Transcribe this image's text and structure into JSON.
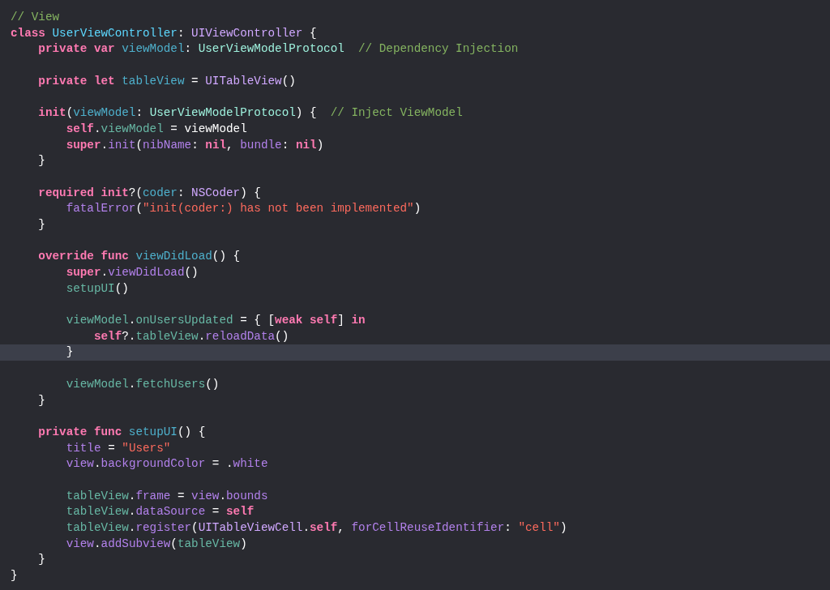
{
  "editor": {
    "lines": [
      {
        "current": false,
        "tokens": [
          {
            "kind": "comment",
            "text": "// View"
          }
        ]
      },
      {
        "current": false,
        "tokens": [
          {
            "kind": "keyword",
            "text": "class "
          },
          {
            "kind": "decltype",
            "text": "UserViewController"
          },
          {
            "kind": "plain",
            "text": ": "
          },
          {
            "kind": "systype",
            "text": "UIViewController"
          },
          {
            "kind": "plain",
            "text": " {"
          }
        ]
      },
      {
        "current": false,
        "tokens": [
          {
            "kind": "keyword",
            "text": "    private var "
          },
          {
            "kind": "decl",
            "text": "viewModel"
          },
          {
            "kind": "plain",
            "text": ": "
          },
          {
            "kind": "projtype",
            "text": "UserViewModelProtocol"
          },
          {
            "kind": "comment",
            "text": "  // Dependency Injection"
          }
        ]
      },
      {
        "current": false
      },
      {
        "current": false,
        "tokens": [
          {
            "kind": "keyword",
            "text": "    private let "
          },
          {
            "kind": "decl",
            "text": "tableView"
          },
          {
            "kind": "plain",
            "text": " = "
          },
          {
            "kind": "systype",
            "text": "UITableView"
          },
          {
            "kind": "plain",
            "text": "()"
          }
        ]
      },
      {
        "current": false
      },
      {
        "current": false,
        "tokens": [
          {
            "kind": "keyword",
            "text": "    init"
          },
          {
            "kind": "plain",
            "text": "("
          },
          {
            "kind": "decl",
            "text": "viewModel"
          },
          {
            "kind": "plain",
            "text": ": "
          },
          {
            "kind": "projtype",
            "text": "UserViewModelProtocol"
          },
          {
            "kind": "plain",
            "text": ") {  "
          },
          {
            "kind": "comment",
            "text": "// Inject ViewModel"
          }
        ]
      },
      {
        "current": false,
        "tokens": [
          {
            "kind": "keyword",
            "text": "        self"
          },
          {
            "kind": "plain",
            "text": "."
          },
          {
            "kind": "projmember",
            "text": "viewModel"
          },
          {
            "kind": "plain",
            "text": " = viewModel"
          }
        ]
      },
      {
        "current": false,
        "tokens": [
          {
            "kind": "keyword",
            "text": "        super"
          },
          {
            "kind": "plain",
            "text": "."
          },
          {
            "kind": "sysmember",
            "text": "init"
          },
          {
            "kind": "plain",
            "text": "("
          },
          {
            "kind": "sysmember",
            "text": "nibName"
          },
          {
            "kind": "plain",
            "text": ": "
          },
          {
            "kind": "keyword",
            "text": "nil"
          },
          {
            "kind": "plain",
            "text": ", "
          },
          {
            "kind": "sysmember",
            "text": "bundle"
          },
          {
            "kind": "plain",
            "text": ": "
          },
          {
            "kind": "keyword",
            "text": "nil"
          },
          {
            "kind": "plain",
            "text": ")"
          }
        ]
      },
      {
        "current": false,
        "tokens": [
          {
            "kind": "plain",
            "text": "    }"
          }
        ]
      },
      {
        "current": false
      },
      {
        "current": false,
        "tokens": [
          {
            "kind": "keyword",
            "text": "    required init"
          },
          {
            "kind": "plain",
            "text": "?("
          },
          {
            "kind": "decl",
            "text": "coder"
          },
          {
            "kind": "plain",
            "text": ": "
          },
          {
            "kind": "systype",
            "text": "NSCoder"
          },
          {
            "kind": "plain",
            "text": ") {"
          }
        ]
      },
      {
        "current": false,
        "tokens": [
          {
            "kind": "sysmember",
            "text": "        fatalError"
          },
          {
            "kind": "plain",
            "text": "("
          },
          {
            "kind": "string",
            "text": "\"init(coder:) has not been implemented\""
          },
          {
            "kind": "plain",
            "text": ")"
          }
        ]
      },
      {
        "current": false,
        "tokens": [
          {
            "kind": "plain",
            "text": "    }"
          }
        ]
      },
      {
        "current": false
      },
      {
        "current": false,
        "tokens": [
          {
            "kind": "keyword",
            "text": "    override func "
          },
          {
            "kind": "decl",
            "text": "viewDidLoad"
          },
          {
            "kind": "plain",
            "text": "() {"
          }
        ]
      },
      {
        "current": false,
        "tokens": [
          {
            "kind": "keyword",
            "text": "        super"
          },
          {
            "kind": "plain",
            "text": "."
          },
          {
            "kind": "sysmember",
            "text": "viewDidLoad"
          },
          {
            "kind": "plain",
            "text": "()"
          }
        ]
      },
      {
        "current": false,
        "tokens": [
          {
            "kind": "projmember",
            "text": "        setupUI"
          },
          {
            "kind": "plain",
            "text": "()"
          }
        ]
      },
      {
        "current": false
      },
      {
        "current": false,
        "tokens": [
          {
            "kind": "projmember",
            "text": "        viewModel"
          },
          {
            "kind": "plain",
            "text": "."
          },
          {
            "kind": "projmember",
            "text": "onUsersUpdated"
          },
          {
            "kind": "plain",
            "text": " = { ["
          },
          {
            "kind": "keyword",
            "text": "weak self"
          },
          {
            "kind": "plain",
            "text": "] "
          },
          {
            "kind": "keyword",
            "text": "in"
          }
        ]
      },
      {
        "current": false,
        "tokens": [
          {
            "kind": "keyword",
            "text": "            self"
          },
          {
            "kind": "plain",
            "text": "?."
          },
          {
            "kind": "projmember",
            "text": "tableView"
          },
          {
            "kind": "plain",
            "text": "."
          },
          {
            "kind": "sysmember",
            "text": "reloadData"
          },
          {
            "kind": "plain",
            "text": "()"
          }
        ]
      },
      {
        "current": true,
        "tokens": [
          {
            "kind": "plain",
            "text": "        }"
          }
        ]
      },
      {
        "current": false
      },
      {
        "current": false,
        "tokens": [
          {
            "kind": "projmember",
            "text": "        viewModel"
          },
          {
            "kind": "plain",
            "text": "."
          },
          {
            "kind": "projmember",
            "text": "fetchUsers"
          },
          {
            "kind": "plain",
            "text": "()"
          }
        ]
      },
      {
        "current": false,
        "tokens": [
          {
            "kind": "plain",
            "text": "    }"
          }
        ]
      },
      {
        "current": false
      },
      {
        "current": false,
        "tokens": [
          {
            "kind": "keyword",
            "text": "    private func "
          },
          {
            "kind": "decl",
            "text": "setupUI"
          },
          {
            "kind": "plain",
            "text": "() {"
          }
        ]
      },
      {
        "current": false,
        "tokens": [
          {
            "kind": "sysmember",
            "text": "        title"
          },
          {
            "kind": "plain",
            "text": " = "
          },
          {
            "kind": "string",
            "text": "\"Users\""
          }
        ]
      },
      {
        "current": false,
        "tokens": [
          {
            "kind": "sysmember",
            "text": "        view"
          },
          {
            "kind": "plain",
            "text": "."
          },
          {
            "kind": "sysmember",
            "text": "backgroundColor"
          },
          {
            "kind": "plain",
            "text": " = ."
          },
          {
            "kind": "sysmember",
            "text": "white"
          }
        ]
      },
      {
        "current": false
      },
      {
        "current": false,
        "tokens": [
          {
            "kind": "projmember",
            "text": "        tableView"
          },
          {
            "kind": "plain",
            "text": "."
          },
          {
            "kind": "sysmember",
            "text": "frame"
          },
          {
            "kind": "plain",
            "text": " = "
          },
          {
            "kind": "sysmember",
            "text": "view"
          },
          {
            "kind": "plain",
            "text": "."
          },
          {
            "kind": "sysmember",
            "text": "bounds"
          }
        ]
      },
      {
        "current": false,
        "tokens": [
          {
            "kind": "projmember",
            "text": "        tableView"
          },
          {
            "kind": "plain",
            "text": "."
          },
          {
            "kind": "sysmember",
            "text": "dataSource"
          },
          {
            "kind": "plain",
            "text": " = "
          },
          {
            "kind": "keyword",
            "text": "self"
          }
        ]
      },
      {
        "current": false,
        "tokens": [
          {
            "kind": "projmember",
            "text": "        tableView"
          },
          {
            "kind": "plain",
            "text": "."
          },
          {
            "kind": "sysmember",
            "text": "register"
          },
          {
            "kind": "plain",
            "text": "("
          },
          {
            "kind": "systype",
            "text": "UITableViewCell"
          },
          {
            "kind": "plain",
            "text": "."
          },
          {
            "kind": "keyword",
            "text": "self"
          },
          {
            "kind": "plain",
            "text": ", "
          },
          {
            "kind": "sysmember",
            "text": "forCellReuseIdentifier"
          },
          {
            "kind": "plain",
            "text": ": "
          },
          {
            "kind": "string",
            "text": "\"cell\""
          },
          {
            "kind": "plain",
            "text": ")"
          }
        ]
      },
      {
        "current": false,
        "tokens": [
          {
            "kind": "sysmember",
            "text": "        view"
          },
          {
            "kind": "plain",
            "text": "."
          },
          {
            "kind": "sysmember",
            "text": "addSubview"
          },
          {
            "kind": "plain",
            "text": "("
          },
          {
            "kind": "projmember",
            "text": "tableView"
          },
          {
            "kind": "plain",
            "text": ")"
          }
        ]
      },
      {
        "current": false,
        "tokens": [
          {
            "kind": "plain",
            "text": "    }"
          }
        ]
      },
      {
        "current": false,
        "tokens": [
          {
            "kind": "plain",
            "text": "}"
          }
        ]
      }
    ]
  }
}
